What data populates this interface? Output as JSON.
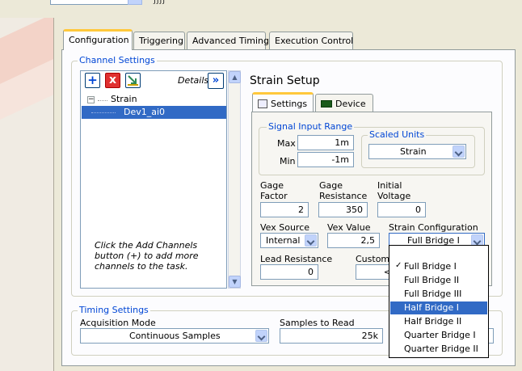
{
  "topbar": {
    "glyph": "ʃʃʃʃ"
  },
  "tabs": [
    {
      "label": "Configuration",
      "active": true
    },
    {
      "label": "Triggering",
      "active": false
    },
    {
      "label": "Advanced Timing",
      "active": false
    },
    {
      "label": "Execution Control",
      "active": false
    }
  ],
  "channel_settings": {
    "legend": "Channel Settings",
    "toolbar": {
      "add_icon": "+",
      "remove_icon": "x",
      "config_icon": "config-icon"
    },
    "details_label": "Details",
    "details_icon": "»",
    "tree": {
      "root": "Strain",
      "child": "Dev1_ai0"
    },
    "hint": "Click the Add Channels button (+) to add more channels to the task."
  },
  "strain_setup": {
    "title": "Strain Setup",
    "tabs": [
      {
        "label": "Settings",
        "active": true
      },
      {
        "label": "Device",
        "active": false
      }
    ],
    "signal_input_range": {
      "legend": "Signal Input Range",
      "max_label": "Max",
      "max_value": "1m",
      "min_label": "Min",
      "min_value": "-1m"
    },
    "scaled_units": {
      "legend": "Scaled Units",
      "value": "Strain"
    },
    "gage_factor": {
      "label": "Gage Factor",
      "value": "2"
    },
    "gage_resistance": {
      "label": "Gage Resistance",
      "value": "350"
    },
    "initial_voltage": {
      "label": "Initial Voltage",
      "value": "0"
    },
    "vex_source": {
      "label": "Vex Source",
      "value": "Internal"
    },
    "vex_value": {
      "label": "Vex Value",
      "value": "2,5"
    },
    "strain_configuration": {
      "label": "Strain Configuration",
      "value": "Full Bridge I"
    },
    "lead_resistance": {
      "label": "Lead Resistance",
      "value": "0"
    },
    "custom": {
      "label": "Custom S",
      "value": "<"
    }
  },
  "dropdown": {
    "options": [
      "Full Bridge I",
      "Full Bridge II",
      "Full Bridge III",
      "Half Bridge I",
      "Half Bridge II",
      "Quarter Bridge I",
      "Quarter Bridge II"
    ],
    "checked_index": 0,
    "highlighted_index": 3,
    "check_glyph": "✓"
  },
  "timing_settings": {
    "legend": "Timing Settings",
    "acquisition_mode": {
      "label": "Acquisition Mode",
      "value": "Continuous Samples"
    },
    "samples_to_read": {
      "label": "Samples to Read",
      "value": "25k"
    }
  }
}
